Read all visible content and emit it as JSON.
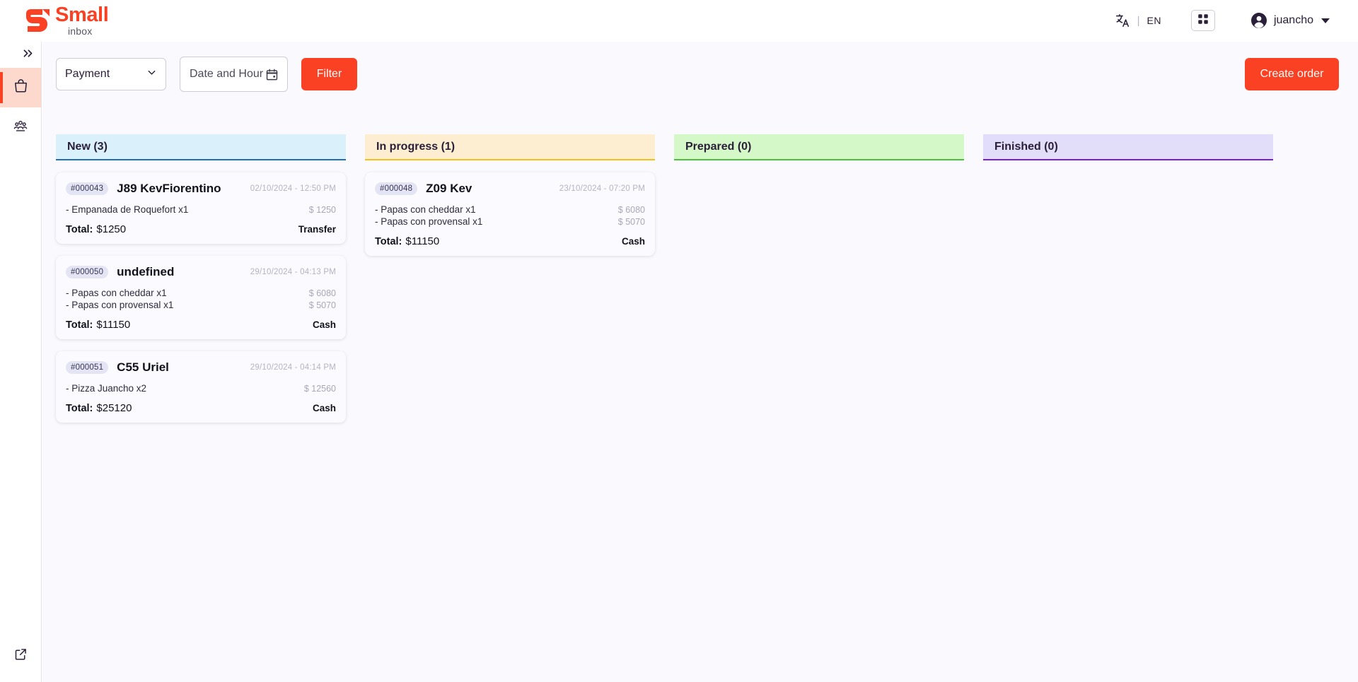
{
  "brand": {
    "name": "Small",
    "sub": "inbox",
    "logo_icon": "small-inbox-logo",
    "accent": "#fb4123"
  },
  "header": {
    "language_icon": "translate-icon",
    "language_separator": "|",
    "language_code": "EN",
    "apps_icon": "grid-apps-icon",
    "avatar_icon": "user-avatar-icon",
    "user_name": "juancho",
    "caret_icon": "chevron-down-icon"
  },
  "sidebar": {
    "toggle_icon": "chevron-double-right-icon",
    "items": [
      {
        "icon": "shopping-bag-icon",
        "name": "orders",
        "active": true
      },
      {
        "icon": "people-group-icon",
        "name": "customers",
        "active": false
      }
    ],
    "bottom": {
      "icon": "external-link-icon",
      "name": "open-external"
    }
  },
  "toolbar": {
    "payment_select_value": "Payment",
    "payment_select_icon": "chevron-down-icon",
    "date_placeholder": "Date and Hour",
    "date_value": "",
    "calendar_icon": "calendar-icon",
    "filter_label": "Filter",
    "create_order_label": "Create order"
  },
  "board": {
    "columns": [
      {
        "title": "New (3)",
        "header_bg": "#daf0fb",
        "border_color": "#1f6fb2",
        "cards": [
          {
            "order_id": "#000043",
            "customer": "J89 KevFiorentino",
            "time": "02/10/2024 - 12:50 PM",
            "items": [
              {
                "name": "- Empanada de Roquefort x1",
                "price": "$ 1250"
              }
            ],
            "total_label": "Total:",
            "total_value": "$1250",
            "payment": "Transfer"
          },
          {
            "order_id": "#000050",
            "customer": "undefined",
            "time": "29/10/2024 - 04:13 PM",
            "items": [
              {
                "name": "- Papas con cheddar x1",
                "price": "$ 6080"
              },
              {
                "name": "- Papas con provensal x1",
                "price": "$ 5070"
              }
            ],
            "total_label": "Total:",
            "total_value": "$11150",
            "payment": "Cash"
          },
          {
            "order_id": "#000051",
            "customer": "C55 Uriel",
            "time": "29/10/2024 - 04:14 PM",
            "items": [
              {
                "name": "- Pizza Juancho x2",
                "price": "$ 12560"
              }
            ],
            "total_label": "Total:",
            "total_value": "$25120",
            "payment": "Cash"
          }
        ]
      },
      {
        "title": "In progress (1)",
        "header_bg": "#fdeed2",
        "border_color": "#f2c21a",
        "cards": [
          {
            "order_id": "#000048",
            "customer": "Z09 Kev",
            "time": "23/10/2024 - 07:20 PM",
            "items": [
              {
                "name": "- Papas con cheddar x1",
                "price": "$ 6080"
              },
              {
                "name": "- Papas con provensal x1",
                "price": "$ 5070"
              }
            ],
            "total_label": "Total:",
            "total_value": "$11150",
            "payment": "Cash"
          }
        ]
      },
      {
        "title": "Prepared (0)",
        "header_bg": "#d5f8c8",
        "border_color": "#4cc13c",
        "cards": []
      },
      {
        "title": "Finished (0)",
        "header_bg": "#e2defa",
        "border_color": "#7a1fd4",
        "cards": []
      }
    ]
  }
}
